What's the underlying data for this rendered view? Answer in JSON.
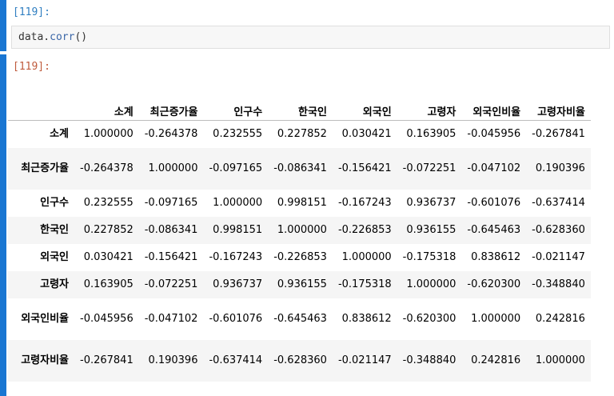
{
  "input_cell": {
    "prompt": "[119]:",
    "code_obj": "data.",
    "code_fn": "corr",
    "code_args": "()"
  },
  "output_cell": {
    "prompt": "[119]:"
  },
  "table": {
    "columns": [
      "소계",
      "최근증가율",
      "인구수",
      "한국인",
      "외국인",
      "고령자",
      "외국인비율",
      "고령자비율"
    ],
    "rows": [
      {
        "label": "소계",
        "values": [
          "1.000000",
          "-0.264378",
          "0.232555",
          "0.227852",
          "0.030421",
          "0.163905",
          "-0.045956",
          "-0.267841"
        ]
      },
      {
        "label": "최근증가율",
        "values": [
          "-0.264378",
          "1.000000",
          "-0.097165",
          "-0.086341",
          "-0.156421",
          "-0.072251",
          "-0.047102",
          "0.190396"
        ]
      },
      {
        "label": "인구수",
        "values": [
          "0.232555",
          "-0.097165",
          "1.000000",
          "0.998151",
          "-0.167243",
          "0.936737",
          "-0.601076",
          "-0.637414"
        ]
      },
      {
        "label": "한국인",
        "values": [
          "0.227852",
          "-0.086341",
          "0.998151",
          "1.000000",
          "-0.226853",
          "0.936155",
          "-0.645463",
          "-0.628360"
        ]
      },
      {
        "label": "외국인",
        "values": [
          "0.030421",
          "-0.156421",
          "-0.167243",
          "-0.226853",
          "1.000000",
          "-0.175318",
          "0.838612",
          "-0.021147"
        ]
      },
      {
        "label": "고령자",
        "values": [
          "0.163905",
          "-0.072251",
          "0.936737",
          "0.936155",
          "-0.175318",
          "1.000000",
          "-0.620300",
          "-0.348840"
        ]
      },
      {
        "label": "외국인비율",
        "values": [
          "-0.045956",
          "-0.047102",
          "-0.601076",
          "-0.645463",
          "0.838612",
          "-0.620300",
          "1.000000",
          "0.242816"
        ]
      },
      {
        "label": "고령자비율",
        "values": [
          "-0.267841",
          "0.190396",
          "-0.637414",
          "-0.628360",
          "-0.021147",
          "-0.348840",
          "0.242816",
          "1.000000"
        ]
      }
    ]
  },
  "colors": {
    "cell_bar": "#1976d2",
    "prompt_in": "#307fc1",
    "prompt_out": "#bf5b3d"
  }
}
